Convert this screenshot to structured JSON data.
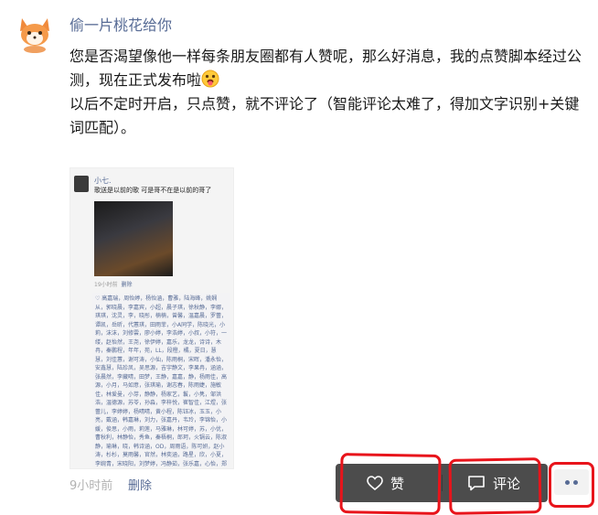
{
  "post": {
    "author": "偷一片桃花给你",
    "text_line1": "您是否渴望像他一样每条朋友圈都有人赞呢，那么好消息，我的点赞脚本经过公测，现在正式发布啦",
    "text_line2": "以后不定时开启，只点赞，就不评论了（智能评论太难了，得加文字识别+关键词匹配）。",
    "time": "9小时前",
    "delete_label": "删除"
  },
  "screenshot": {
    "name": "小七.",
    "text": "歌送是以前的歌 可是哥不在是以前的哥了",
    "time": "19小时前",
    "delete_label": "删除",
    "likes": "♡ 高嘉瑞，周怡婷，杨怡涵，曹雅，陆海峰，姚娴从，郭晓晨，李嘉宾，小超，晨子琪，徐秋静，李娜，琪琪，沈灵，李，晓彤，楠楠，曾馨，温嘉晨，罗蕾，谭凯，岳昕，代蕙琪，田雨菲，小A同学，陈晓光，小莉，沫沫，刘修雲，廖小婷，李浩婷，小叔，小符，一缕，赵怡然，王尧，徐伊婷，嘉乐，龙龙，诗诗，木冉，秦鹏程，年年，苑，LL，段橙，橘，夏日，慧慧，刘佳蕙，谢可涛，小仙，陈雨桐，宋晖，潘永怡，安鑫慧，陆珍凤，吴思源，吉宇静文，李果冉，涵涵，张晨然，李藏晴，田梦，王静，嘉嘉，静，杨雨佳，高源，小月，马如意，张琪瑜，谢志春，陈雨婕，施敏佳，林爱曼，小芽，静静，杨家艺，鬟，小隽，邹洪浩，温德源，苏苓，孙淼，李梓悦，崔智佳，江煜，张蕾儿，李婷婷，杨晴晴，黄小程，陈钰冰，玉玉，小亮，戴涵，韩嘉琳，刘力，张嘉丹，韦玲，李锦怡，小媛，俊思，小雨，莉莲，马雅琳，林可婷，苏，小优，曹秋利，林静怡，秀鱼，秦梧桐，郎珂，火锅云，陈淑静，瑜琳，晓，韩诗涵，OD，周雨语，陈可妍，赵小涛，杉杉，莫雨馨，官然，林奕涵，路星，欣，小夏，李婉青，宋晓阳，刘梦婷，冯静茹，张乐嘉，心怡，郑浩，瑾，丁雨浩，小崔，张怡，苏怡涵，张静，程颖欣，琳惠，舒曼，小米，周，一一，洋意，温亦婷，林凡萱，陈佳怡，秦千雅，潘双双，茜茜，曹广平，杨依轩，关关，以清风，刘雨馨，胡明，张爱菁，林倩雯，张子"
  },
  "actions": {
    "like_label": "赞",
    "comment_label": "评论"
  },
  "icons": {
    "like": "heart-icon",
    "comment": "comment-icon",
    "more": "more-dots-icon",
    "emoji": "tongue-face-emoji"
  },
  "colors": {
    "link": "#576b95",
    "bar": "#4c4c4c",
    "annotation": "#e8141b"
  }
}
